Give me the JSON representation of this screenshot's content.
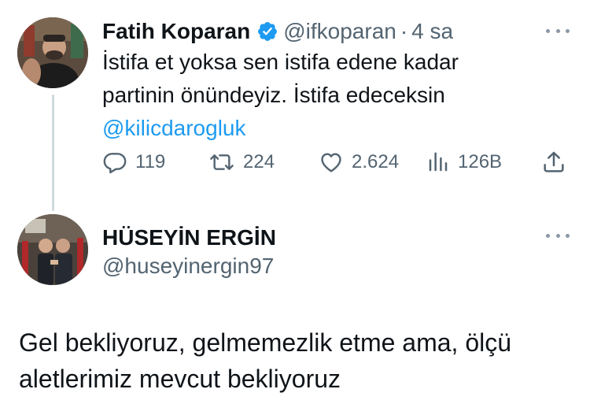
{
  "parent_tweet": {
    "display_name": "Fatih Koparan",
    "handle": "@ifkoparan",
    "separator": "·",
    "time": "4 sa",
    "text_lines": [
      "İstifa et yoksa sen istifa edene kadar",
      "partinin önündeyiz. İstifa edeceksin"
    ],
    "mention": "@kilicdarogluk",
    "stats": {
      "replies": "119",
      "retweets": "224",
      "likes": "2.624",
      "views": "126B"
    },
    "icons": {
      "verified": "verified-badge-icon",
      "reply": "reply-icon",
      "retweet": "retweet-icon",
      "like": "heart-icon",
      "views": "views-icon",
      "share": "share-icon",
      "more": "more-icon"
    }
  },
  "reply_tweet": {
    "display_name": "HÜSEYİN ERGİN",
    "handle": "@huseyinergin97",
    "text_lines": [
      "Gel bekliyoruz, gelmemezlik etme ama, ölçü",
      "aletlerimiz mevcut bekliyoruz"
    ]
  },
  "colors": {
    "text": "#0f1419",
    "secondary": "#536471",
    "accent": "#1d9bf0",
    "thread_line": "#cfd9de"
  }
}
